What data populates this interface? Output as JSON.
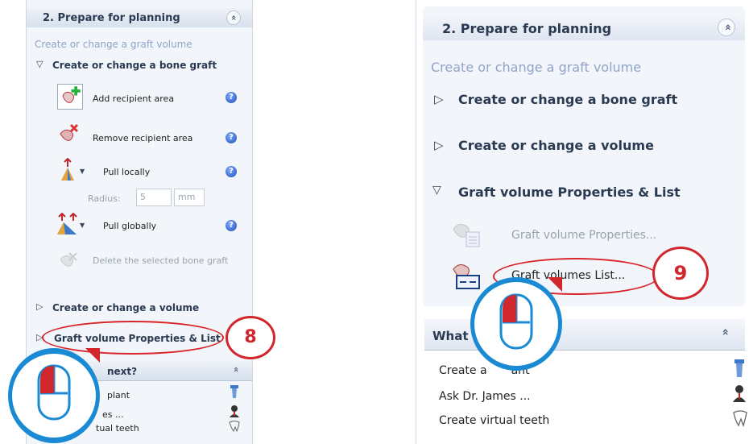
{
  "left": {
    "header": "2. Prepare for planning",
    "collapse": "«",
    "subtitle": "Create or change a graft volume",
    "section1": "Create or change a bone graft",
    "items": {
      "add": "Add recipient area",
      "remove": "Remove recipient area",
      "pull_local": "Pull locally",
      "radius_label": "Radius:",
      "radius_value": "5",
      "radius_unit": "mm",
      "pull_global": "Pull globally",
      "delete": "Delete the selected bone graft"
    },
    "section2": "Create or change a volume",
    "section3": "Graft volume Properties & List",
    "callout": "8",
    "what_next": "next?",
    "list": [
      "plant",
      "es ...",
      "tual teeth"
    ]
  },
  "right": {
    "header": "2. Prepare for planning",
    "collapse": "«",
    "subtitle": "Create or change a graft volume",
    "section1": "Create or change a bone graft",
    "section2": "Create or change a volume",
    "section3": "Graft volume Properties & List",
    "item_properties": "Graft volume Properties...",
    "item_list": "Graft volumes List...",
    "callout": "9",
    "what_next": "What",
    "list": [
      "Create a",
      "ant",
      "Ask Dr. James ...",
      "Create virtual teeth"
    ]
  },
  "colors": {
    "accent_red": "#d1262c",
    "mouse_blue": "#1a8ad4",
    "subtitle_blue": "#8fa4c8"
  },
  "icons": [
    "tooth-add-icon",
    "tooth-remove-icon",
    "pull-locally-icon",
    "pull-globally-icon",
    "delete-graft-icon",
    "help-icon",
    "graft-properties-icon",
    "graft-list-icon",
    "implant-icon",
    "doctor-icon",
    "virtual-teeth-icon",
    "mouse-icon"
  ]
}
